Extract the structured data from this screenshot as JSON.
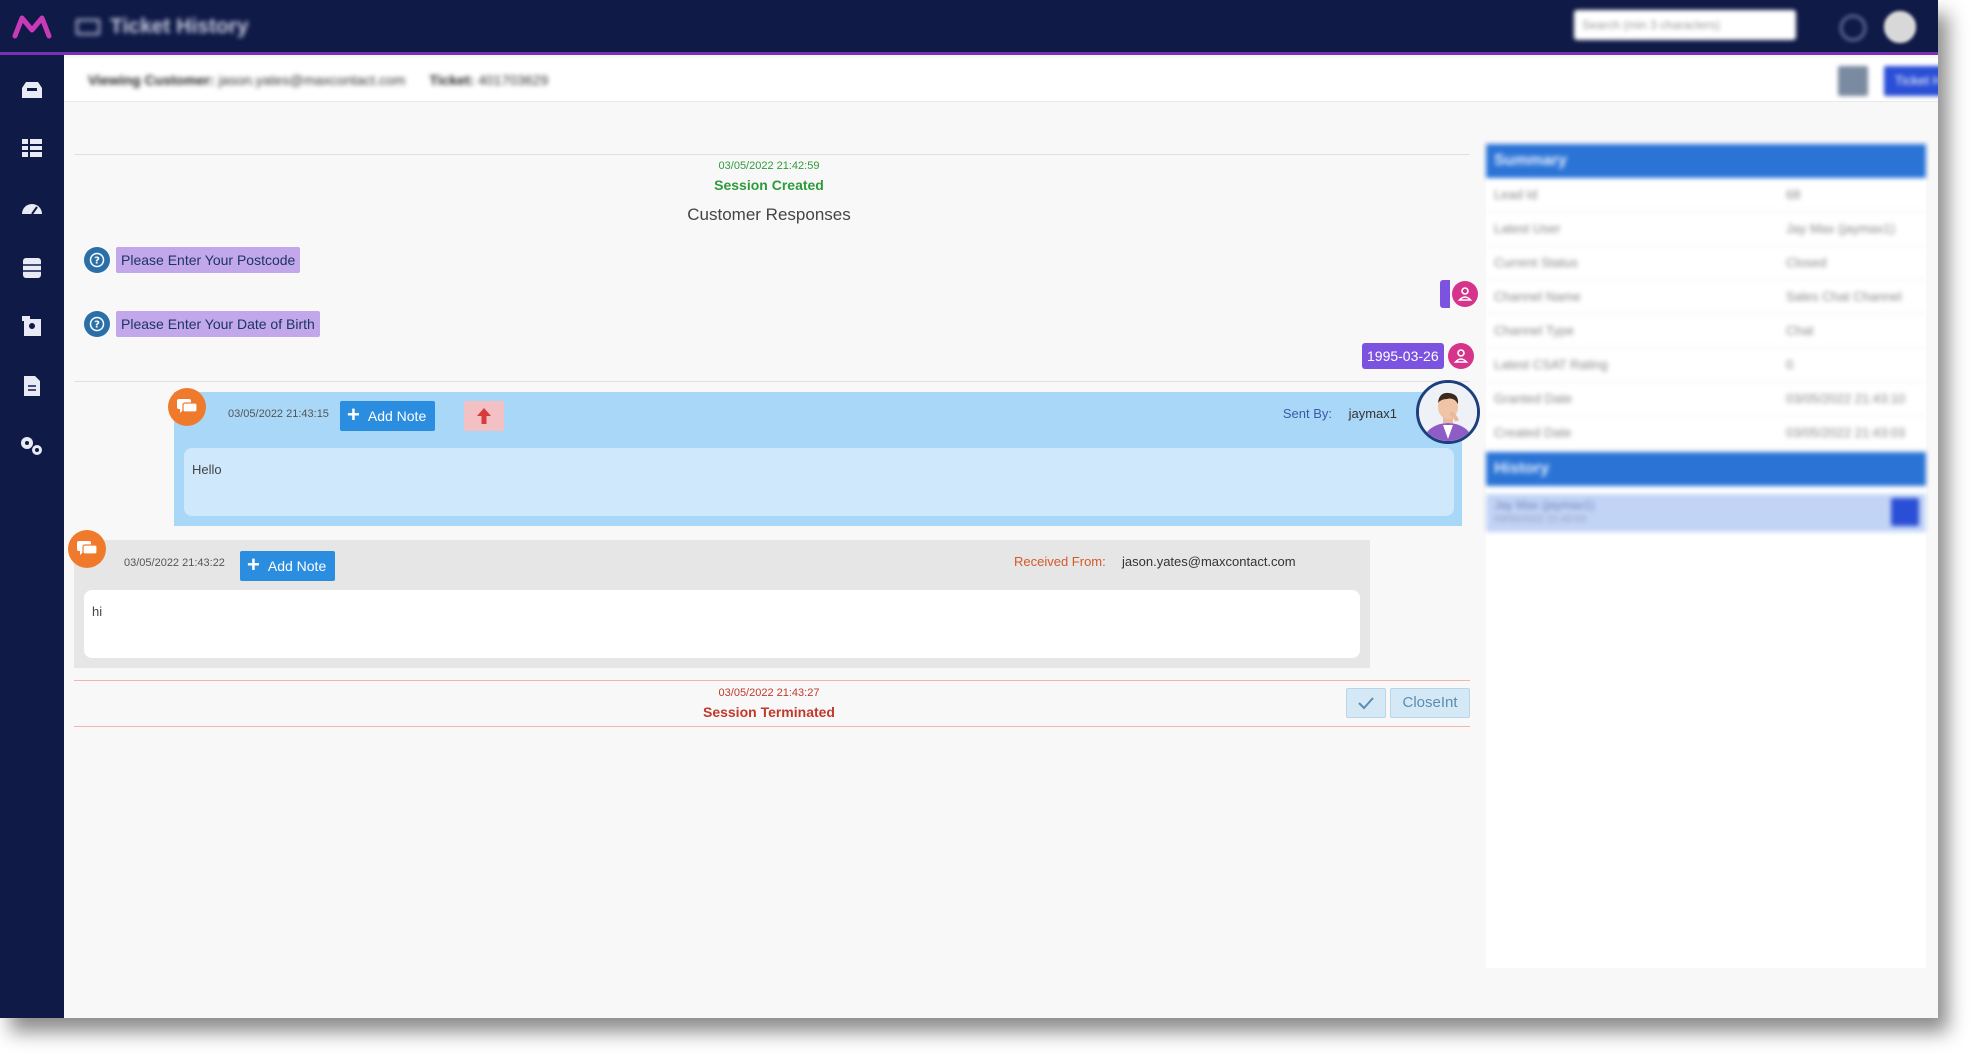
{
  "app": {
    "title": "Ticket History",
    "search_placeholder": "Search (min 3 characters)"
  },
  "subheader": {
    "customer_label": "Viewing Customer:",
    "customer_value": "jason.yates@maxcontact.com",
    "ticket_label": "Ticket:",
    "ticket_value": "401703629",
    "history_button": "Ticket History"
  },
  "session": {
    "created_time": "03/05/2022 21:42:59",
    "created_label": "Session Created",
    "responses_title": "Customer Responses",
    "questions": [
      {
        "text": "Please Enter Your Postcode",
        "answer": ""
      },
      {
        "text": "Please Enter Your Date of Birth",
        "answer": "1995-03-26"
      }
    ],
    "terminated_time": "03/05/2022 21:43:27",
    "terminated_label": "Session Terminated",
    "closeint_label": "CloseInt"
  },
  "messages": {
    "sent": {
      "time": "03/05/2022 21:43:15",
      "add_note": "Add Note",
      "sent_by_label": "Sent By:",
      "sent_by_value": "jaymax1",
      "body": "Hello"
    },
    "received": {
      "time": "03/05/2022 21:43:22",
      "add_note": "Add Note",
      "received_from_label": "Received From:",
      "received_from_value": "jason.yates@maxcontact.com",
      "body": "hi"
    }
  },
  "summary": {
    "title": "Summary",
    "rows": [
      {
        "label": "Lead Id",
        "value": "68"
      },
      {
        "label": "Latest User",
        "value": "Jay Max (jaymax1)"
      },
      {
        "label": "Current Status",
        "value": "Closed"
      },
      {
        "label": "Channel Name",
        "value": "Sales Chat Channel"
      },
      {
        "label": "Channel Type",
        "value": "Chat"
      },
      {
        "label": "Latest CSAT Rating",
        "value": "0"
      },
      {
        "label": "Granted Date",
        "value": "03/05/2022 21:43:10"
      },
      {
        "label": "Created Date",
        "value": "03/05/2022 21:43:03"
      }
    ]
  },
  "history": {
    "title": "History",
    "items": [
      {
        "name": "Jay Max (jaymax1)",
        "date": "03/05/2022 21:43:03"
      }
    ]
  },
  "colors": {
    "nav": "#0f1a47",
    "accent": "#7b2fb5",
    "add_note": "#2b8de0",
    "success": "#2e9b3a",
    "danger": "#c0392b"
  }
}
